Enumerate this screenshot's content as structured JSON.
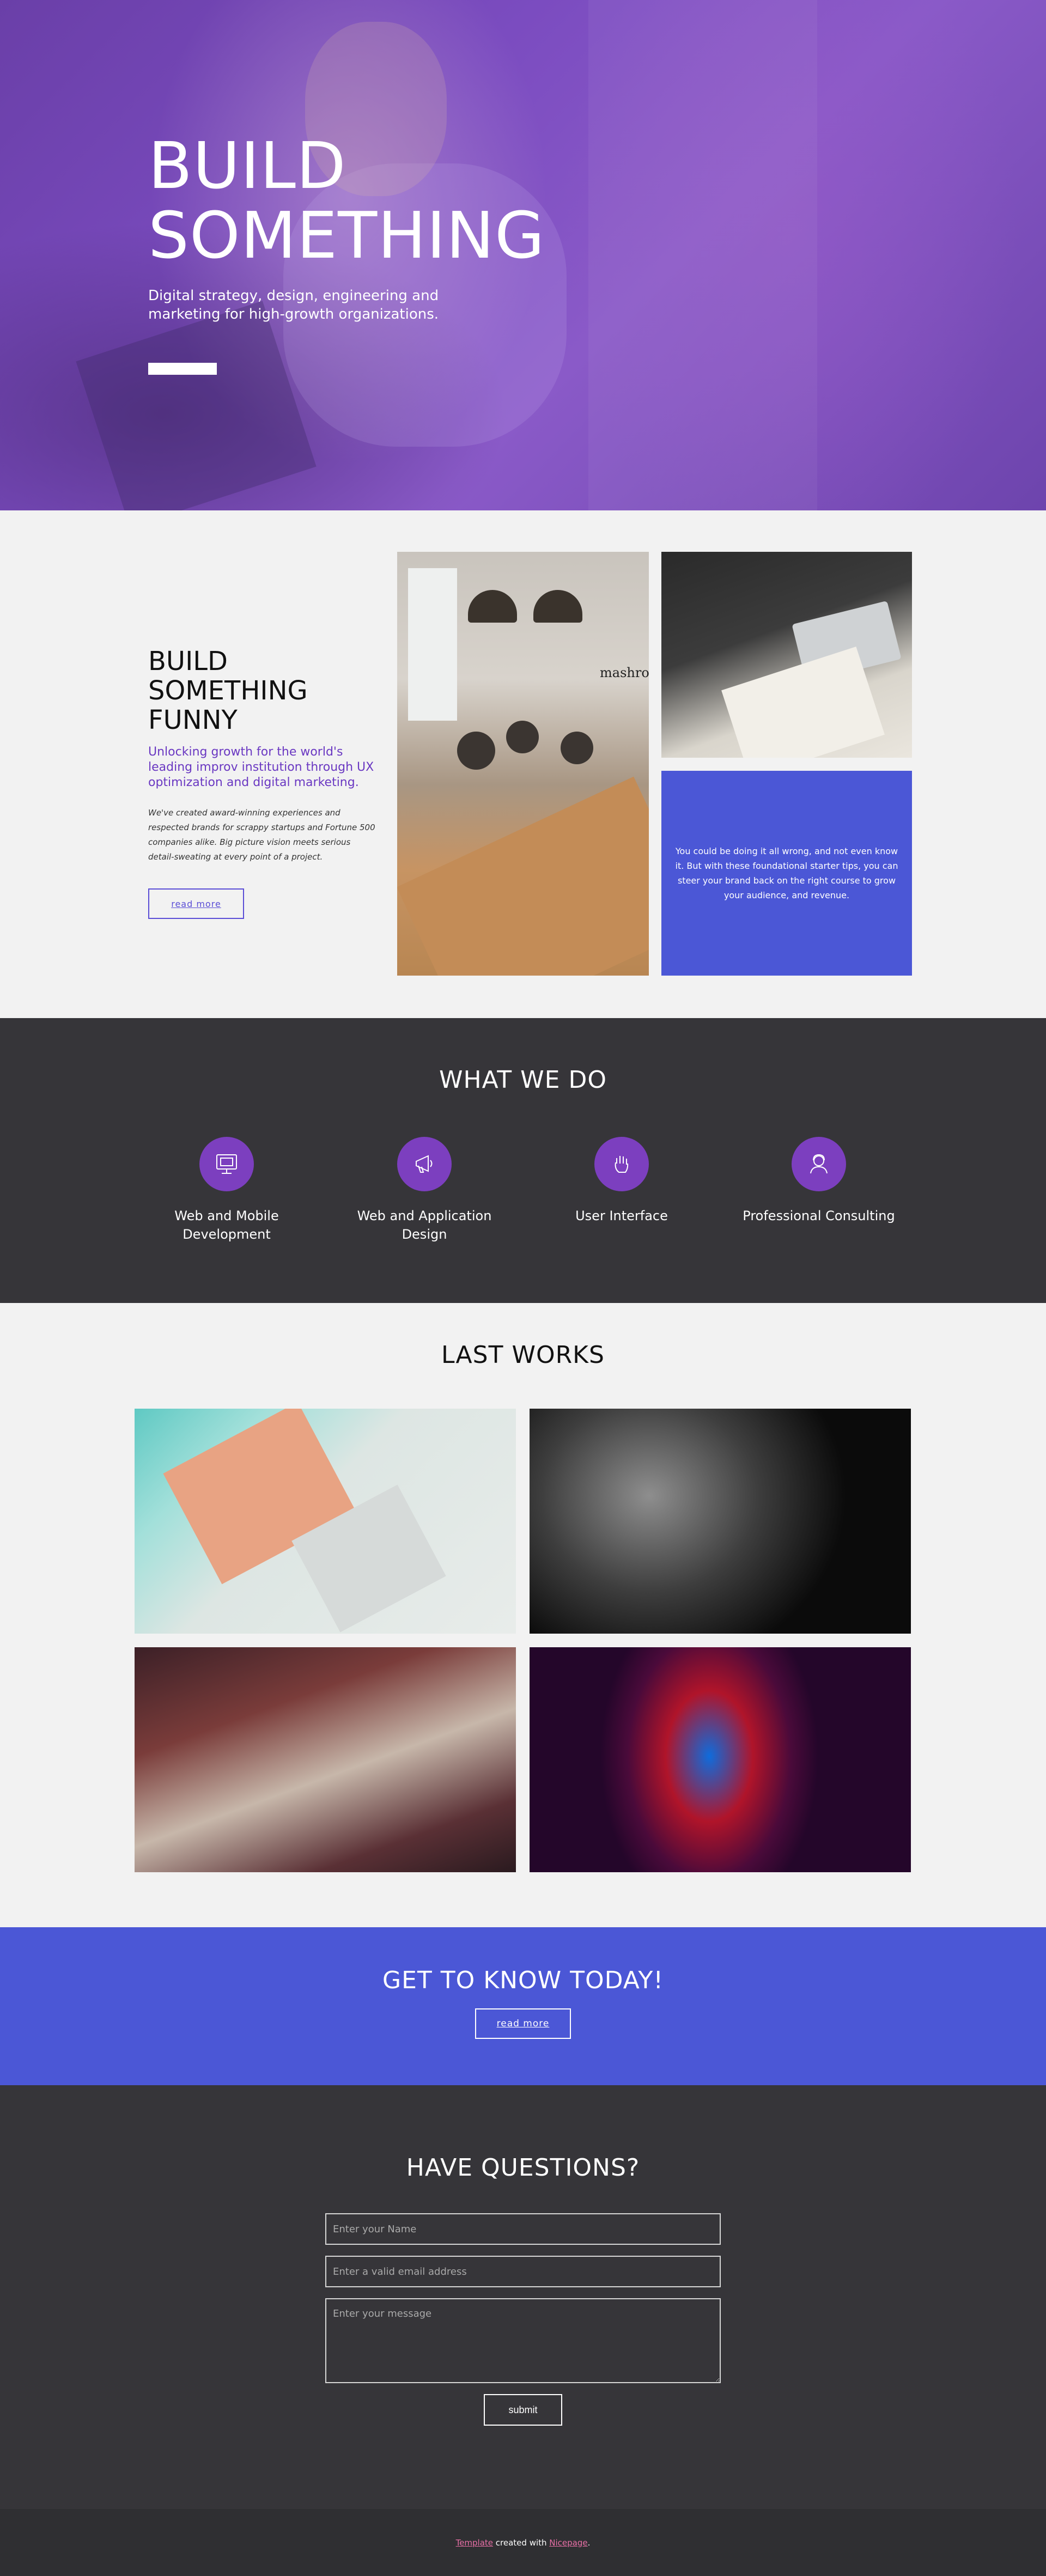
{
  "hero": {
    "title_line1": "BUILD",
    "title_line2": "SOMETHING",
    "subtitle": "Digital strategy, design, engineering and marketing for high-growth organizations."
  },
  "funny": {
    "title": "BUILD SOMETHING FUNNY",
    "lead": "Unlocking growth for the world's leading improv institution through UX optimization and digital marketing.",
    "body": "We've created award-winning experiences and respected brands for scrappy startups and Fortune 500 companies alike. Big picture vision meets serious detail-sweating at every point of a project.",
    "button": "read more",
    "card_text": "You could be doing it all wrong, and not even know it. But with these foundational starter tips, you can steer your brand back on the right course to grow your audience, and revenue.",
    "cafe_sign": "mashro"
  },
  "what_we_do": {
    "title": "WHAT WE DO",
    "services": [
      {
        "label": "Web and Mobile Development",
        "icon": "monitor-icon"
      },
      {
        "label": "Web and Application Design",
        "icon": "megaphone-icon"
      },
      {
        "label": "User Interface",
        "icon": "hand-icon"
      },
      {
        "label": "Professional Consulting",
        "icon": "consultant-icon"
      }
    ],
    "accent": "#7c3fbf"
  },
  "last_works": {
    "title": "LAST WORKS"
  },
  "get_to_know": {
    "title": "GET TO KNOW TODAY!",
    "button": "read more"
  },
  "questions": {
    "title": "HAVE QUESTIONS?",
    "name_placeholder": "Enter your Name",
    "email_placeholder": "Enter a valid email address",
    "message_placeholder": "Enter your message",
    "submit": "submit"
  },
  "footer": {
    "link1": "Template",
    "middle": " created with ",
    "link2": "Nicepage",
    "end": "."
  },
  "colors": {
    "hero_purple": "#7b4cc0",
    "blue": "#4b57d6",
    "dark": "#363539",
    "light": "#f2f2f2"
  }
}
